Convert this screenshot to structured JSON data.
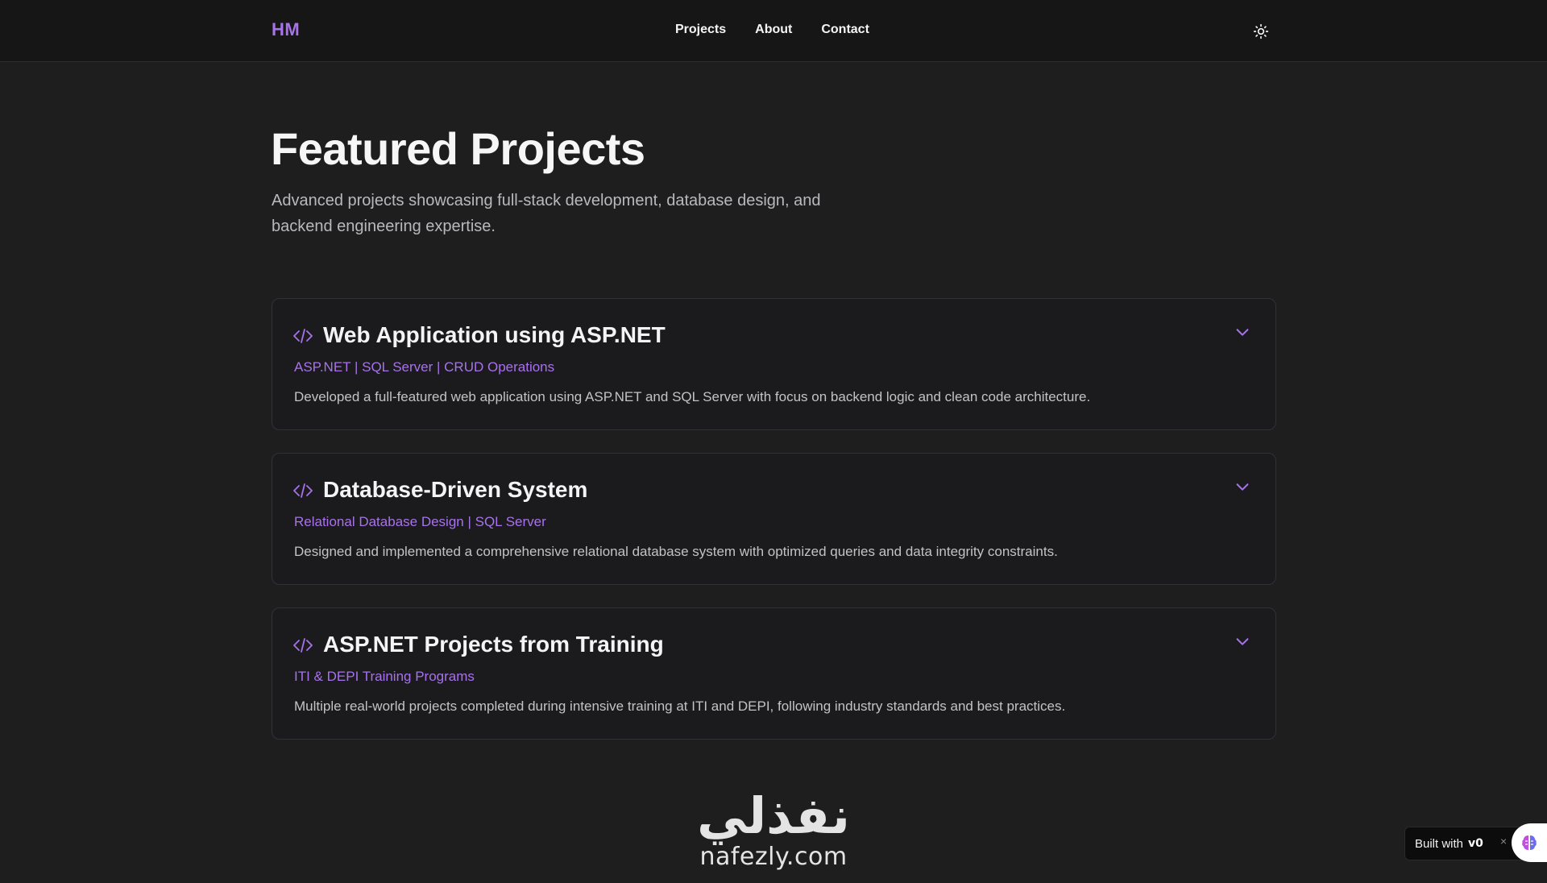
{
  "navbar": {
    "logo": "HM",
    "links": [
      {
        "label": "Projects"
      },
      {
        "label": "About"
      },
      {
        "label": "Contact"
      }
    ],
    "theme_toggle_icon": "sun-icon"
  },
  "hero": {
    "title": "Featured Projects",
    "subtitle": "Advanced projects showcasing full-stack development, database design, and backend engineering expertise."
  },
  "projects": [
    {
      "title": "Web Application using ASP.NET",
      "tags": "ASP.NET | SQL Server | CRUD Operations",
      "description": "Developed a full-featured web application using ASP.NET and SQL Server with focus on backend logic and clean code architecture."
    },
    {
      "title": "Database-Driven System",
      "tags": "Relational Database Design | SQL Server",
      "description": "Designed and implemented a comprehensive relational database system with optimized queries and data integrity constraints."
    },
    {
      "title": "ASP.NET Projects from Training",
      "tags": "ITI & DEPI Training Programs",
      "description": "Multiple real-world projects completed during intensive training at ITI and DEPI, following industry standards and best practices."
    }
  ],
  "watermark": {
    "arabic": "نفذلي",
    "latin": "nafezly.com"
  },
  "built_with": {
    "text": "Built with",
    "brand": "v0",
    "close": "×"
  },
  "colors": {
    "background": "#1e1e1f",
    "navbar": "#161617",
    "accent": "#a772ea",
    "card_border": "#323236",
    "text_primary": "#f4f4f4",
    "text_secondary": "#c3c3c7"
  }
}
